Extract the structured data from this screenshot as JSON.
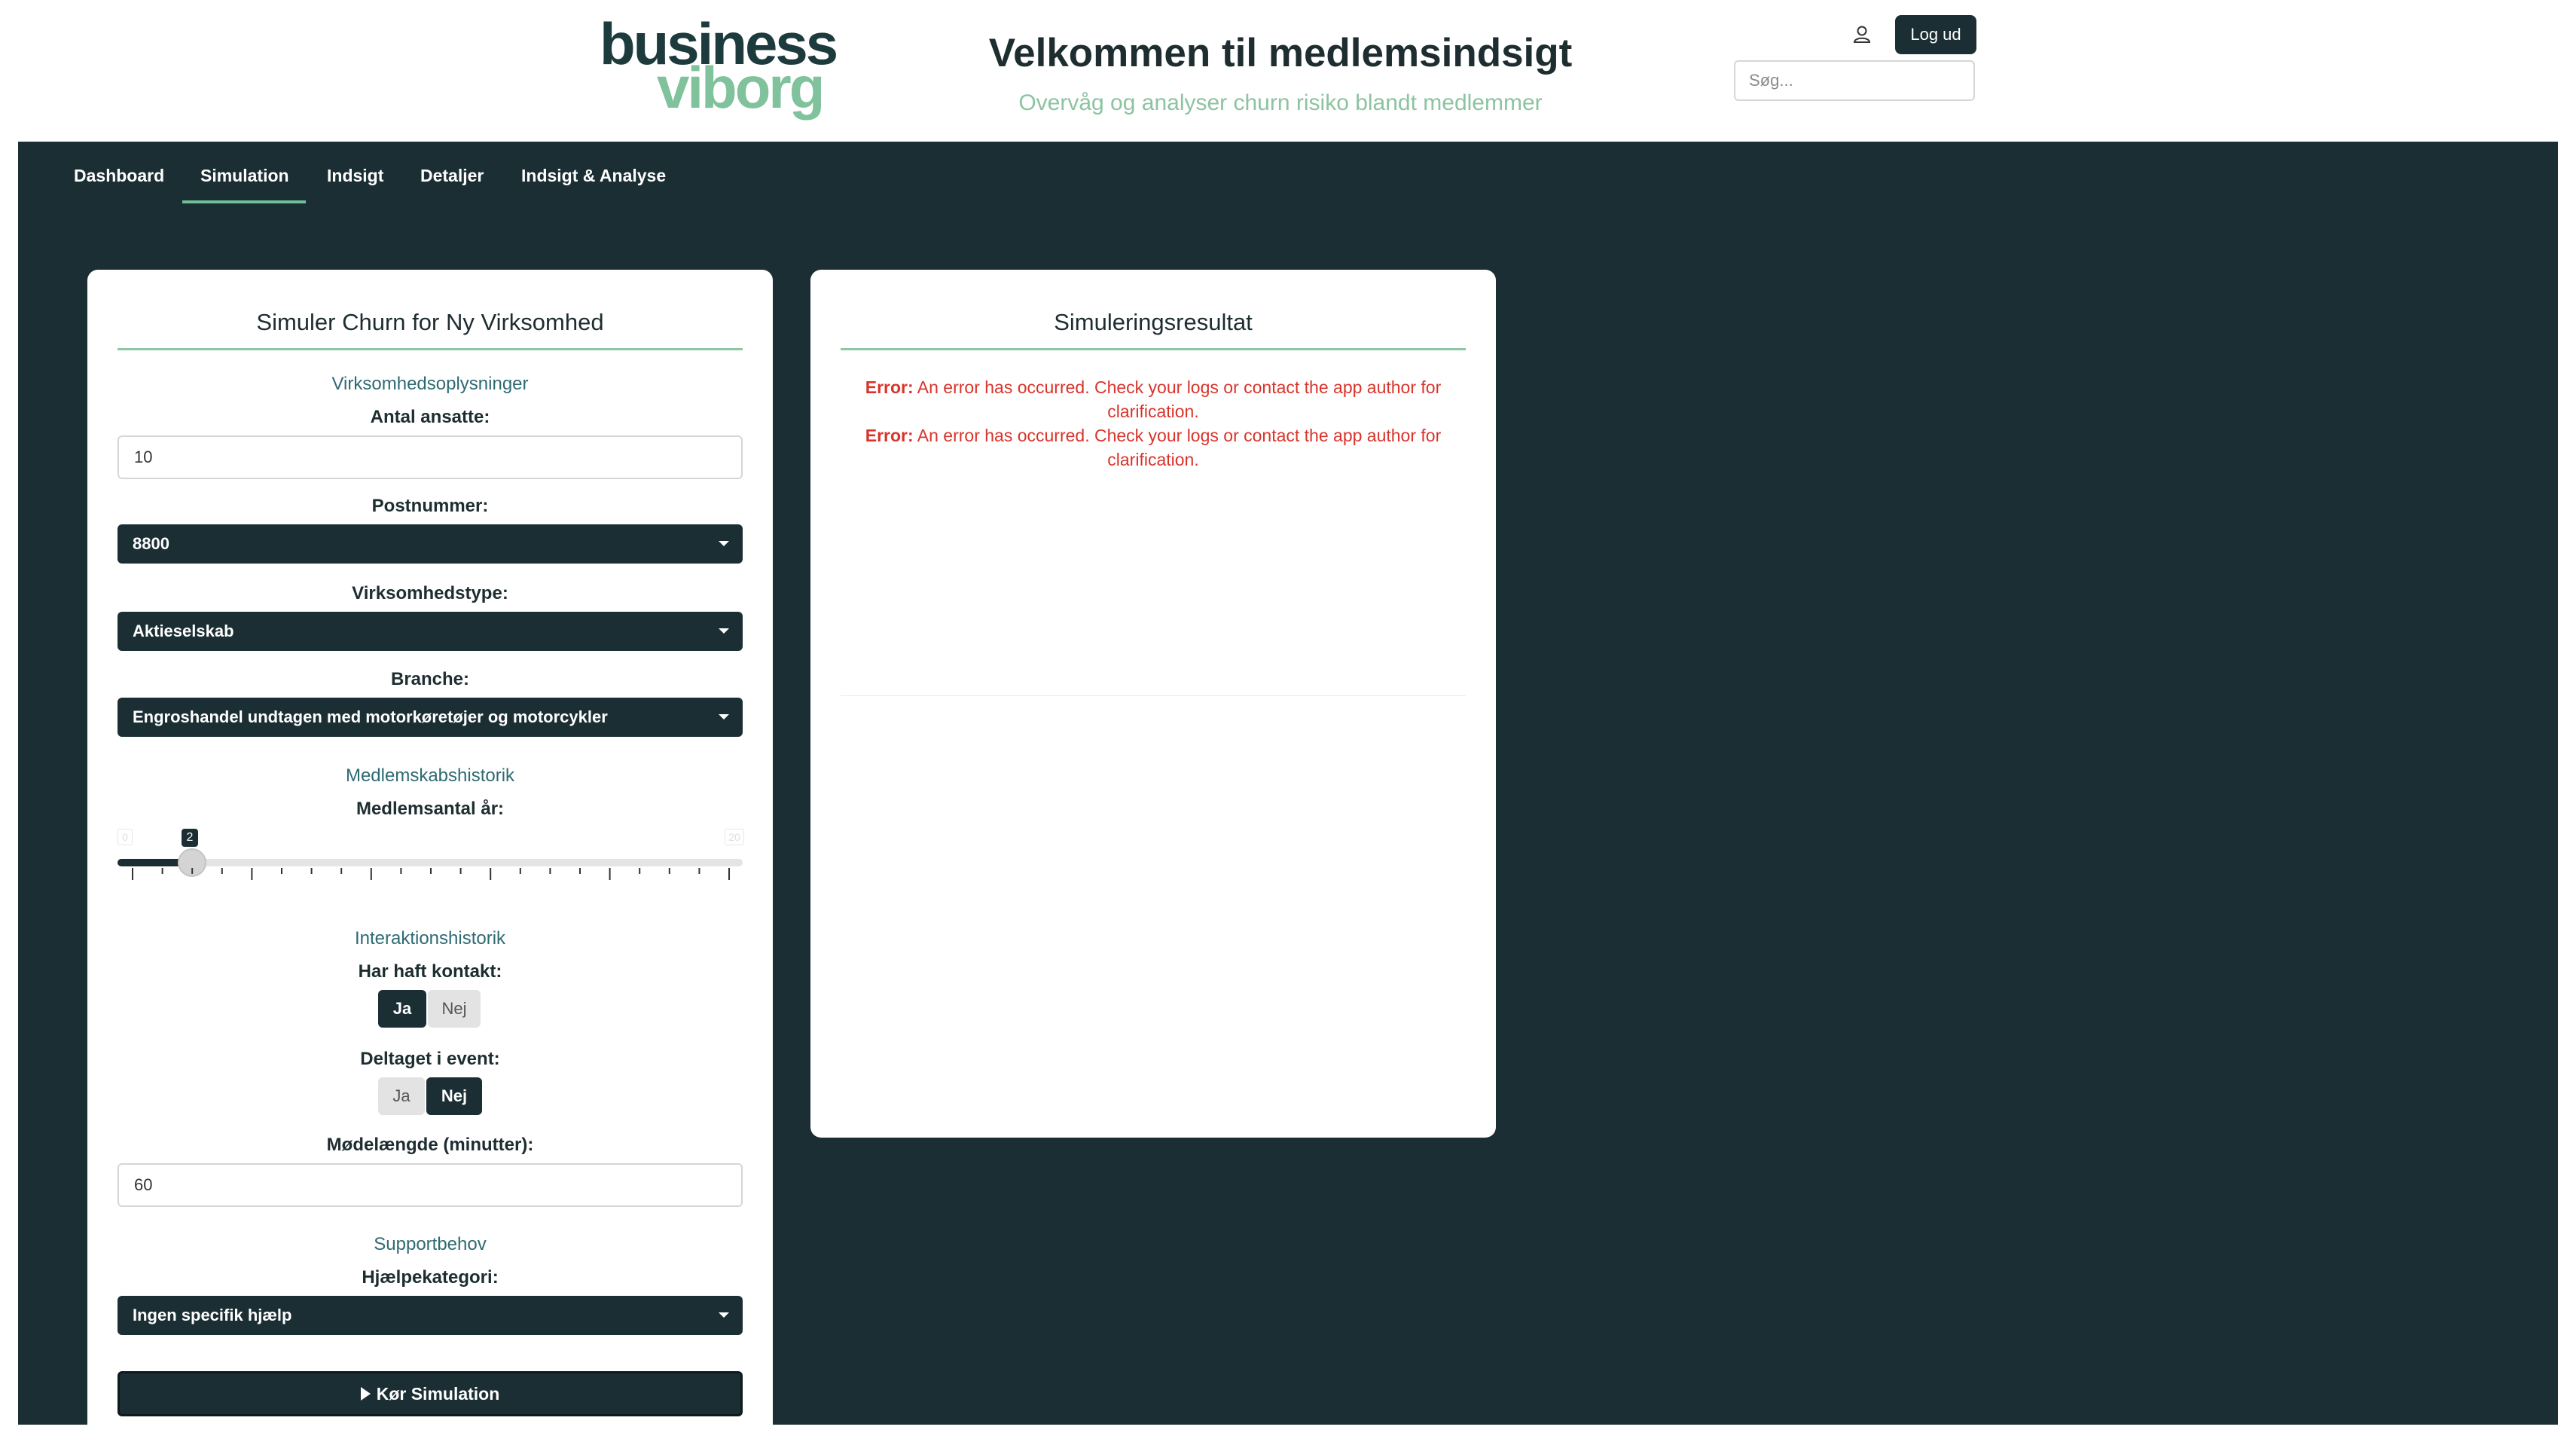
{
  "header": {
    "logo_line1": "business",
    "logo_line2": "viborg",
    "title": "Velkommen til medlemsindsigt",
    "subtitle": "Overvåg og analyser churn risiko blandt medlemmer",
    "logout_label": "Log ud",
    "search_placeholder": "Søg..."
  },
  "nav": {
    "items": [
      "Dashboard",
      "Simulation",
      "Indsigt",
      "Detaljer",
      "Indsigt & Analyse"
    ],
    "active": "Simulation"
  },
  "form": {
    "title": "Simuler Churn for Ny Virksomhed",
    "section_company": "Virksomhedsoplysninger",
    "employees_label": "Antal ansatte:",
    "employees_value": "10",
    "postcode_label": "Postnummer:",
    "postcode_value": "8800",
    "company_type_label": "Virksomhedstype:",
    "company_type_value": "Aktieselskab",
    "industry_label": "Branche:",
    "industry_value": "Engroshandel undtagen med motorkøretøjer og motorcykler",
    "section_membership": "Medlemskabshistorik",
    "member_years_label": "Medlemsantal år:",
    "member_years_value": "2",
    "member_years_min": "0",
    "member_years_max": "20",
    "section_interaction": "Interaktionshistorik",
    "contact_label": "Har haft kontakt:",
    "contact_yes": "Ja",
    "contact_no": "Nej",
    "contact_selected": "Ja",
    "event_label": "Deltaget i event:",
    "event_yes": "Ja",
    "event_no": "Nej",
    "event_selected": "Nej",
    "meeting_label": "Mødelængde (minutter):",
    "meeting_value": "60",
    "section_support": "Supportbehov",
    "help_label": "Hjælpekategori:",
    "help_value": "Ingen specifik hjælp",
    "run_label": "Kør Simulation"
  },
  "result": {
    "title": "Simuleringsresultat",
    "errors": [
      {
        "prefix": "Error:",
        "message": "An error has occurred. Check your logs or contact the app author for clarification."
      },
      {
        "prefix": "Error:",
        "message": "An error has occurred. Check your logs or contact the app author for clarification."
      }
    ]
  },
  "colors": {
    "dark": "#1b2e33",
    "accent_green": "#7fc29b",
    "error_red": "#d9342b"
  }
}
